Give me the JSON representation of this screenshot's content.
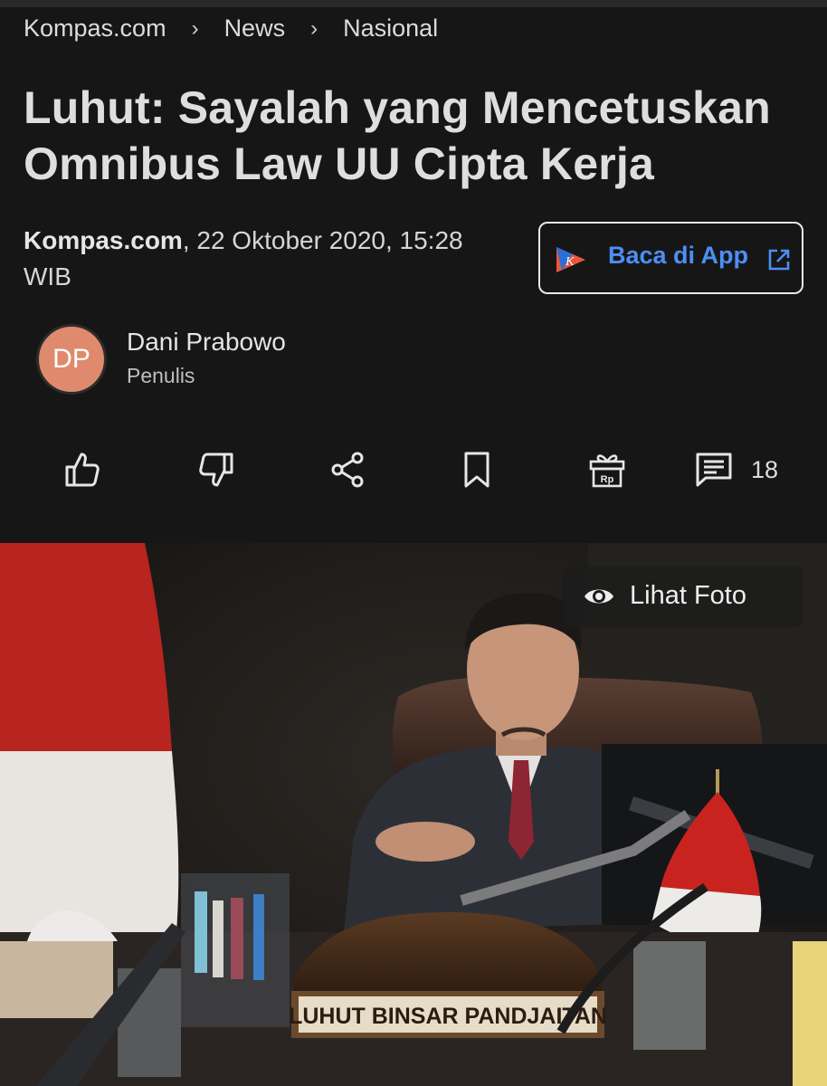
{
  "breadcrumb": {
    "site": "Kompas.com",
    "section": "News",
    "subsection": "Nasional",
    "separator": "›"
  },
  "article": {
    "title_line1": "Luhut: Sayalah yang Mencetuskan",
    "title_line2": "Omnibus Law UU Cipta Kerja",
    "source": "Kompas.com",
    "date": ", 22 Oktober 2020, 15:28",
    "timezone": "WIB"
  },
  "app_button": {
    "label": "Baca di App",
    "logo_letter": "K"
  },
  "author": {
    "initials": "DP",
    "name": "Dani Prabowo",
    "role": "Penulis"
  },
  "actions": {
    "comment_count": "18",
    "gift_label": "Rp"
  },
  "photo": {
    "view_label": "Lihat Foto",
    "nameplate": "LUHUT BINSAR PANDJAITAN"
  },
  "colors": {
    "background": "#161616",
    "accent": "#4d8ef5",
    "avatar": "#e08a6d"
  }
}
